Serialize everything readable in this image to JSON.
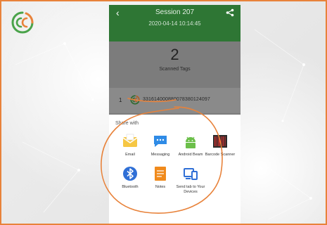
{
  "phone": {
    "title": "Session 207",
    "datetime": "2020-04-14 10:14:45",
    "back_icon": "chevron-left-icon",
    "share_icon": "share-icon"
  },
  "summary": {
    "count": "2",
    "label": "Scanned Tags"
  },
  "tag": {
    "index": "1",
    "code": "331614000880078380124097",
    "icon": "cc-logo-icon"
  },
  "share_sheet": {
    "heading": "Share with",
    "apps": [
      {
        "label": "Email",
        "icon": "email-icon"
      },
      {
        "label": "Messaging",
        "icon": "messaging-icon"
      },
      {
        "label": "Android Beam",
        "icon": "android-beam-icon"
      },
      {
        "label": "Barcode Scanner",
        "icon": "barcode-scanner-icon"
      },
      {
        "label": "Bluetooth",
        "icon": "bluetooth-icon"
      },
      {
        "label": "Notes",
        "icon": "notes-icon"
      },
      {
        "label": "Send tab to Your Devices",
        "icon": "send-to-devices-icon"
      }
    ]
  },
  "colors": {
    "frame_border": "#e8823a",
    "appbar": "#2e7634",
    "annotation": "#e8823a",
    "logo_green": "#4aa34a",
    "logo_orange": "#e8823a"
  }
}
